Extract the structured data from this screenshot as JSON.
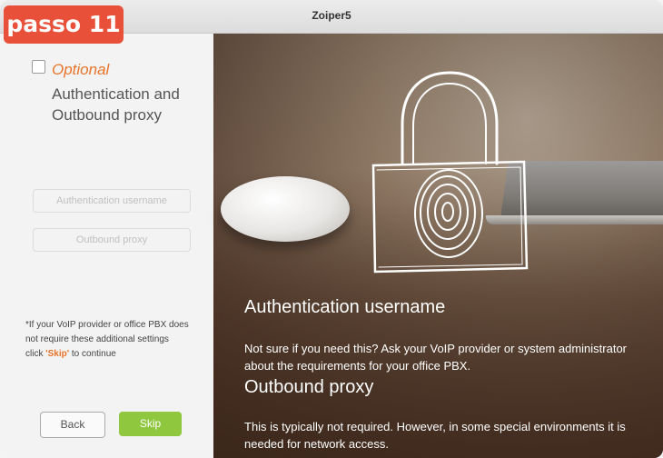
{
  "badge": "passo 11",
  "window": {
    "title": "Zoiper5"
  },
  "left": {
    "optional_label": "Optional",
    "heading": "Authentication and Outbound proxy",
    "auth_username_placeholder": "Authentication username",
    "outbound_proxy_placeholder": "Outbound proxy",
    "note_prefix": "*If your VoIP provider or office PBX does not require these additional settings click ",
    "note_skip": "'Skip'",
    "note_suffix": " to continue",
    "back_label": "Back",
    "skip_label": "Skip"
  },
  "right": {
    "auth_title": "Authentication username",
    "auth_text": "Not sure if you need this? Ask your VoIP provider or system administrator about the requirements for your office PBX.",
    "proxy_title": "Outbound proxy",
    "proxy_text": "This is typically not required. However, in some special environments it is needed for network access."
  },
  "colors": {
    "badge": "#e8503a",
    "accent": "#e8742a",
    "skip_button": "#8fc73e"
  }
}
